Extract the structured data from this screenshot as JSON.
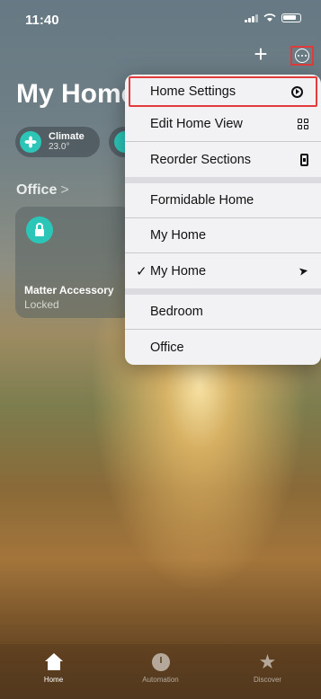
{
  "status": {
    "time": "11:40"
  },
  "header": {
    "title": "My Home",
    "add_label": "+"
  },
  "chips": [
    {
      "label": "Climate",
      "value": "23.0°"
    }
  ],
  "section": {
    "title": "Office",
    "chevron": ">"
  },
  "tile": {
    "name": "Matter Accessory",
    "state": "Locked"
  },
  "menu": {
    "items": [
      {
        "label": "Home Settings",
        "icon": "settings-circle-icon"
      },
      {
        "label": "Edit Home View",
        "icon": "grid-icon"
      },
      {
        "label": "Reorder Sections",
        "icon": "phone-icon"
      },
      {
        "label": "Formidable Home"
      },
      {
        "label": "My Home"
      },
      {
        "label": "My Home",
        "checked": true,
        "icon": "location-arrow-icon"
      },
      {
        "label": "Bedroom"
      },
      {
        "label": "Office"
      }
    ],
    "check": "✓",
    "loc_glyph": "➤"
  },
  "tabs": [
    {
      "label": "Home",
      "active": true
    },
    {
      "label": "Automation"
    },
    {
      "label": "Discover"
    }
  ],
  "tab_star": "★",
  "colors": {
    "accent": "#2cc6b8",
    "highlight": "#e13b3b"
  }
}
